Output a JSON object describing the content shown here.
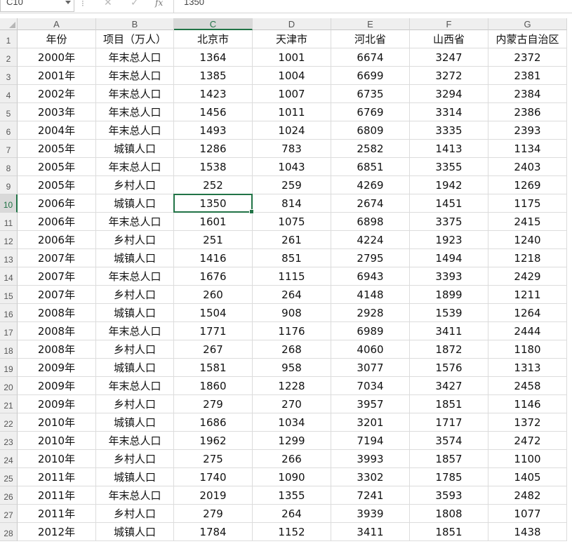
{
  "formula_bar": {
    "name_box": "C10",
    "cancel_icon": "✕",
    "enter_icon": "✓",
    "fx_label": "fx",
    "formula_value": "1350"
  },
  "selection": {
    "cell": "C10",
    "column": "C",
    "row": "10"
  },
  "columns": [
    "A",
    "B",
    "C",
    "D",
    "E",
    "F",
    "G"
  ],
  "rows": [
    [
      "年份",
      "项目（万人）",
      "北京市",
      "天津市",
      "河北省",
      "山西省",
      "内蒙古自治区"
    ],
    [
      "2000年",
      "年末总人口",
      "1364",
      "1001",
      "6674",
      "3247",
      "2372"
    ],
    [
      "2001年",
      "年末总人口",
      "1385",
      "1004",
      "6699",
      "3272",
      "2381"
    ],
    [
      "2002年",
      "年末总人口",
      "1423",
      "1007",
      "6735",
      "3294",
      "2384"
    ],
    [
      "2003年",
      "年末总人口",
      "1456",
      "1011",
      "6769",
      "3314",
      "2386"
    ],
    [
      "2004年",
      "年末总人口",
      "1493",
      "1024",
      "6809",
      "3335",
      "2393"
    ],
    [
      "2005年",
      "城镇人口",
      "1286",
      "783",
      "2582",
      "1413",
      "1134"
    ],
    [
      "2005年",
      "年末总人口",
      "1538",
      "1043",
      "6851",
      "3355",
      "2403"
    ],
    [
      "2005年",
      "乡村人口",
      "252",
      "259",
      "4269",
      "1942",
      "1269"
    ],
    [
      "2006年",
      "城镇人口",
      "1350",
      "814",
      "2674",
      "1451",
      "1175"
    ],
    [
      "2006年",
      "年末总人口",
      "1601",
      "1075",
      "6898",
      "3375",
      "2415"
    ],
    [
      "2006年",
      "乡村人口",
      "251",
      "261",
      "4224",
      "1923",
      "1240"
    ],
    [
      "2007年",
      "城镇人口",
      "1416",
      "851",
      "2795",
      "1494",
      "1218"
    ],
    [
      "2007年",
      "年末总人口",
      "1676",
      "1115",
      "6943",
      "3393",
      "2429"
    ],
    [
      "2007年",
      "乡村人口",
      "260",
      "264",
      "4148",
      "1899",
      "1211"
    ],
    [
      "2008年",
      "城镇人口",
      "1504",
      "908",
      "2928",
      "1539",
      "1264"
    ],
    [
      "2008年",
      "年末总人口",
      "1771",
      "1176",
      "6989",
      "3411",
      "2444"
    ],
    [
      "2008年",
      "乡村人口",
      "267",
      "268",
      "4060",
      "1872",
      "1180"
    ],
    [
      "2009年",
      "城镇人口",
      "1581",
      "958",
      "3077",
      "1576",
      "1313"
    ],
    [
      "2009年",
      "年末总人口",
      "1860",
      "1228",
      "7034",
      "3427",
      "2458"
    ],
    [
      "2009年",
      "乡村人口",
      "279",
      "270",
      "3957",
      "1851",
      "1146"
    ],
    [
      "2010年",
      "城镇人口",
      "1686",
      "1034",
      "3201",
      "1717",
      "1372"
    ],
    [
      "2010年",
      "年末总人口",
      "1962",
      "1299",
      "7194",
      "3574",
      "2472"
    ],
    [
      "2010年",
      "乡村人口",
      "275",
      "266",
      "3993",
      "1857",
      "1100"
    ],
    [
      "2011年",
      "城镇人口",
      "1740",
      "1090",
      "3302",
      "1785",
      "1405"
    ],
    [
      "2011年",
      "年末总人口",
      "2019",
      "1355",
      "7241",
      "3593",
      "2482"
    ],
    [
      "2011年",
      "乡村人口",
      "279",
      "264",
      "3939",
      "1808",
      "1077"
    ],
    [
      "2012年",
      "城镇人口",
      "1784",
      "1152",
      "3411",
      "1851",
      "1438"
    ]
  ]
}
